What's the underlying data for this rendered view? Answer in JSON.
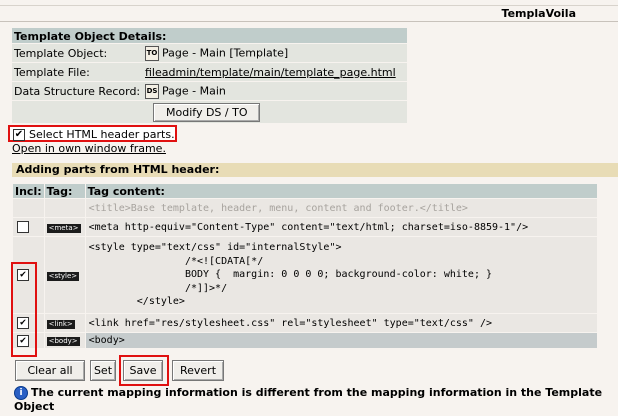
{
  "app_title": "TemplaVoila",
  "details": {
    "header": "Template Object Details:",
    "rows": [
      {
        "label": "Template Object:",
        "icon": "TO",
        "value": "Page - Main [Template]"
      },
      {
        "label": "Template File:",
        "value": "fileadmin/template/main/template_page.html"
      },
      {
        "label": "Data Structure Record:",
        "icon": "DS",
        "value": "Page - Main"
      }
    ],
    "modify_button": "Modify DS / TO"
  },
  "select_header_label": "Select HTML header parts.",
  "open_link": "Open in own window frame.",
  "adding_header": "Adding parts from HTML header:",
  "parts": {
    "columns": [
      "Incl:",
      "Tag:",
      "Tag content:"
    ],
    "rows": [
      {
        "checked": false,
        "tag": "",
        "content": "<title>Base template, header, menu, content and footer.</title>"
      },
      {
        "checked": false,
        "tag": "<meta>",
        "content": "<meta http-equiv=\"Content-Type\" content=\"text/html; charset=iso-8859-1\"/>"
      },
      {
        "checked": true,
        "tag": "<style>",
        "content": "<style type=\"text/css\" id=\"internalStyle\">\n                /*<![CDATA[*/\n                BODY {  margin: 0 0 0 0; background-color: white; }\n                /*]]>*/\n        </style>"
      },
      {
        "checked": true,
        "tag": "<link>",
        "content": "<link href=\"res/stylesheet.css\" rel=\"stylesheet\" type=\"text/css\" />"
      },
      {
        "checked": true,
        "tag": "<body>",
        "content": "<body>"
      }
    ]
  },
  "buttons": {
    "clear_all": "Clear all",
    "set": "Set",
    "save": "Save",
    "revert": "Revert"
  },
  "info_message": "The current mapping information is different from the mapping information in the Template Object",
  "colors": {
    "highlight_red": "#e01010",
    "section_header": "#c0cdcb",
    "adding_header_bg": "#e8dcb6"
  }
}
